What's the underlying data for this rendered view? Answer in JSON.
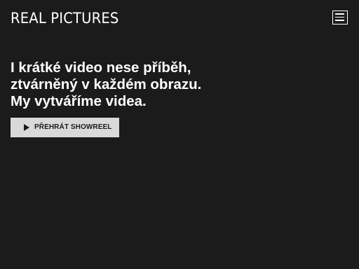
{
  "header": {
    "logo_text": "REAL PICTURES",
    "menu_icon": "hamburger-menu-icon"
  },
  "hero": {
    "headline_lines": [
      "I krátké video nese příběh,",
      "ztvárněný v každém obrazu.",
      "My vytváříme videa."
    ],
    "showreel_button": {
      "label": "PŘEHRÁT SHOWREEL",
      "icon": "play-icon"
    }
  },
  "colors": {
    "background": "#1c1b1b",
    "text": "#ffffff",
    "button_background": "#d9d9d9",
    "button_text": "#1a1a1a"
  }
}
